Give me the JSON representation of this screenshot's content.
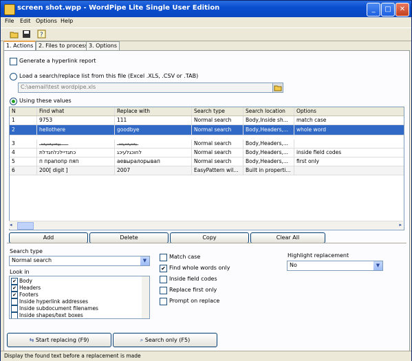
{
  "window": {
    "title": "screen shot.wpp - WordPipe Lite Single User Edition"
  },
  "menu": [
    "File",
    "Edit",
    "Options",
    "Help"
  ],
  "toolbar": {
    "icons": [
      "open-folder-icon",
      "save-icon",
      "help-icon"
    ]
  },
  "tabs": [
    {
      "label": "1. Actions",
      "active": true
    },
    {
      "label": "2. Files to process",
      "active": false
    },
    {
      "label": "3. Options",
      "active": false
    }
  ],
  "actions": {
    "hyperlink_report_label": "Generate a hyperlink report",
    "hyperlink_report_checked": false,
    "load_list_label": "Load a search/replace list from this file (Excel .XLS, .CSV or .TAB)",
    "load_list_selected": false,
    "file_path": "C:\\aemail\\test wordpipe.xls",
    "use_values_label": "Using these values",
    "use_values_selected": true
  },
  "grid": {
    "columns": [
      "N",
      "Find what",
      "Replace with",
      "Search type",
      "Search location",
      "Options"
    ],
    "rows": [
      [
        "1",
        "9753",
        "111",
        "Normal search",
        "Body,Inside sh...",
        "match case"
      ],
      [
        "2",
        "hellothere",
        "goodbye",
        "Normal search",
        "Body,Headers,...",
        "whole word"
      ],
      [
        "3",
        "ـــــبيسيسيسـ",
        "ـبسيسيسـ",
        "Normal search",
        "Body,Headers,...",
        ""
      ],
      [
        "4",
        "כתגדיילכלחגדלת",
        "לחוכגלעיכג",
        "Normal search",
        "Body,Headers,...",
        "inside field codes"
      ],
      [
        "5",
        "п прапопр пяп",
        "аевыралорывап",
        "Normal search",
        "Body,Headers,...",
        "first only"
      ],
      [
        "6",
        "200[ digit ]",
        "2007",
        "EasyPattern wil...",
        "Built in properti...",
        ""
      ]
    ],
    "selected_row": 2
  },
  "buttons": {
    "add": "Add",
    "delete": "Delete",
    "copy": "Copy",
    "clear_all": "Clear All"
  },
  "search_type": {
    "label": "Search type",
    "value": "Normal search"
  },
  "look_in": {
    "label": "Look in",
    "items": [
      {
        "label": "Body",
        "checked": true
      },
      {
        "label": "Headers",
        "checked": true
      },
      {
        "label": "Footers",
        "checked": true
      },
      {
        "label": "Inside hyperlink addresses",
        "checked": false
      },
      {
        "label": "Inside subdocument filenames",
        "checked": false
      },
      {
        "label": "Inside shapes/text boxes",
        "checked": false
      }
    ]
  },
  "options": [
    {
      "label": "Match case",
      "checked": false
    },
    {
      "label": "Find whole words only",
      "checked": true
    },
    {
      "label": "Inside field codes",
      "checked": false
    },
    {
      "label": "Replace first only",
      "checked": false
    },
    {
      "label": "Prompt on replace",
      "checked": false
    }
  ],
  "highlight": {
    "label": "Highlight replacement",
    "value": "No"
  },
  "run": {
    "start": "Start replacing (F9)",
    "search_only": "Search only (F5)"
  },
  "status": "Display the found text before a replacement is made",
  "colors": {
    "selection": "#3169c6",
    "titlebar": "#0a4fcf"
  }
}
